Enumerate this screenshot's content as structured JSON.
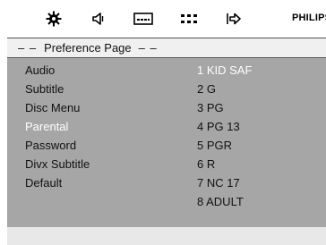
{
  "toolbar": {
    "icons": [
      "gear-icon",
      "speaker-icon",
      "subtitle-icon",
      "dots-grid-icon",
      "exit-arrow-icon"
    ],
    "brand": "PHILIPS"
  },
  "menu": {
    "header_dash_left": "– –",
    "header_title": "Preference Page",
    "header_dash_right": "– –",
    "options": [
      "Audio",
      "Subtitle",
      "Disc Menu",
      "Parental",
      "Password",
      "Divx Subtitle",
      "Default"
    ],
    "active_option": "Parental",
    "values": [
      "1 KID SAF",
      "2 G",
      "3 PG",
      "4 PG 13",
      "5 PGR",
      "6 R",
      "7 NC 17",
      "8 ADULT"
    ],
    "active_value": "1 KID SAF"
  },
  "colors": {
    "panel_bg": "#a6a6a6",
    "header_bg": "#f0f0f0",
    "highlight_text": "#ffffff"
  }
}
